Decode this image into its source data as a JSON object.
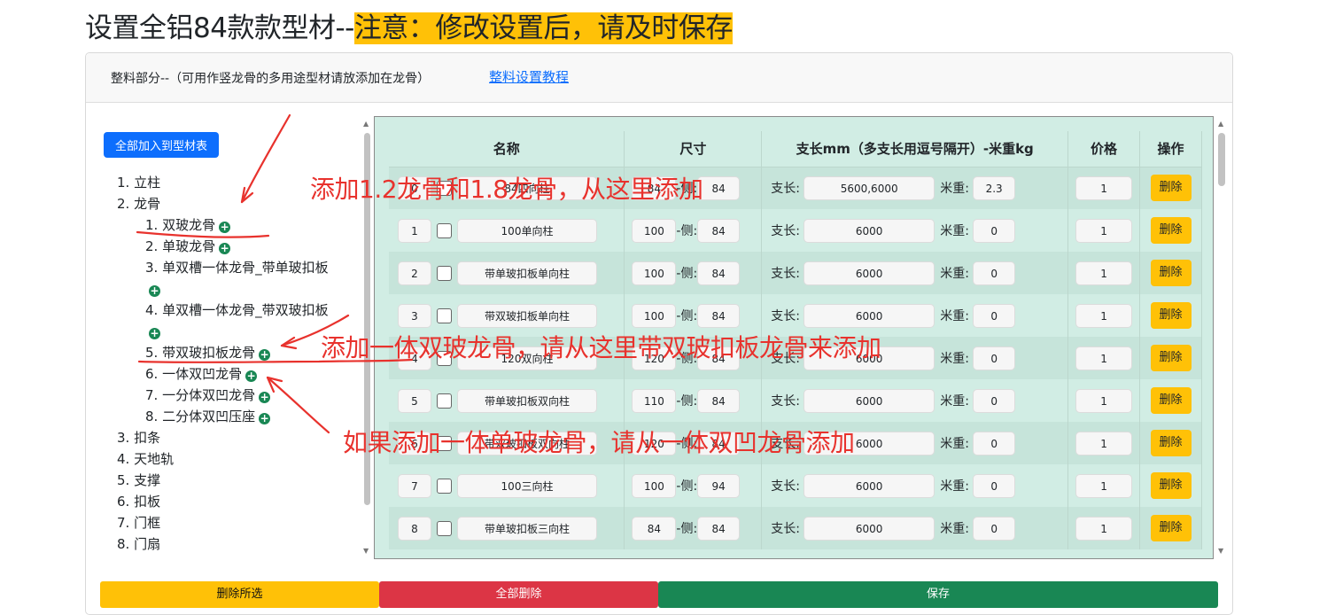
{
  "title": {
    "main": "设置全铝84款款型材--",
    "highlight": "注意：修改设置后，请及时保存"
  },
  "header": {
    "description": "整料部分--（可用作竖龙骨的多用途型材请放添加在龙骨）",
    "tutorial_link": "整料设置教程"
  },
  "tree": {
    "add_all_label": "全部加入到型材表",
    "items": [
      {
        "label": "1. 立柱",
        "level": 0,
        "plus": false
      },
      {
        "label": "2. 龙骨",
        "level": 0,
        "plus": false
      },
      {
        "label": "1. 双玻龙骨",
        "level": 1,
        "plus": true
      },
      {
        "label": "2. 单玻龙骨",
        "level": 1,
        "plus": true
      },
      {
        "label": "3. 单双槽一体龙骨_带单玻扣板",
        "level": 1,
        "plus": false
      },
      {
        "label": "",
        "level": 1,
        "plus": true
      },
      {
        "label": "4. 单双槽一体龙骨_带双玻扣板",
        "level": 1,
        "plus": false
      },
      {
        "label": "",
        "level": 1,
        "plus": true
      },
      {
        "label": "5. 带双玻扣板龙骨",
        "level": 1,
        "plus": true
      },
      {
        "label": "6. 一体双凹龙骨",
        "level": 1,
        "plus": true
      },
      {
        "label": "7. 一分体双凹龙骨",
        "level": 1,
        "plus": true
      },
      {
        "label": "8. 二分体双凹压座",
        "level": 1,
        "plus": true
      },
      {
        "label": "3. 扣条",
        "level": 0,
        "plus": false
      },
      {
        "label": "4. 天地轨",
        "level": 0,
        "plus": false
      },
      {
        "label": "5. 支撑",
        "level": 0,
        "plus": false
      },
      {
        "label": "6. 扣板",
        "level": 0,
        "plus": false
      },
      {
        "label": "7. 门框",
        "level": 0,
        "plus": false
      },
      {
        "label": "8. 门扇",
        "level": 0,
        "plus": false
      }
    ]
  },
  "table": {
    "headers": [
      "名称",
      "尺寸",
      "支长mm（多支长用逗号隔开）-米重kg",
      "价格",
      "操作"
    ],
    "side_label": "-侧:",
    "length_label": "支长:",
    "weight_label": "米重:",
    "delete_label": "删除",
    "rows": [
      {
        "idx": "0",
        "name": "84四向柱",
        "size": "84",
        "side": "84",
        "length": "5600,6000",
        "weight": "2.3",
        "price": "1"
      },
      {
        "idx": "1",
        "name": "100单向柱",
        "size": "100",
        "side": "84",
        "length": "6000",
        "weight": "0",
        "price": "1"
      },
      {
        "idx": "2",
        "name": "带单玻扣板单向柱",
        "size": "100",
        "side": "84",
        "length": "6000",
        "weight": "0",
        "price": "1"
      },
      {
        "idx": "3",
        "name": "带双玻扣板单向柱",
        "size": "100",
        "side": "84",
        "length": "6000",
        "weight": "0",
        "price": "1"
      },
      {
        "idx": "4",
        "name": "120双向柱",
        "size": "120",
        "side": "84",
        "length": "6000",
        "weight": "0",
        "price": "1"
      },
      {
        "idx": "5",
        "name": "带单玻扣板双向柱",
        "size": "110",
        "side": "84",
        "length": "6000",
        "weight": "0",
        "price": "1"
      },
      {
        "idx": "6",
        "name": "带双玻扣板双向柱",
        "size": "120",
        "side": "84",
        "length": "6000",
        "weight": "0",
        "price": "1"
      },
      {
        "idx": "7",
        "name": "100三向柱",
        "size": "100",
        "side": "94",
        "length": "6000",
        "weight": "0",
        "price": "1"
      },
      {
        "idx": "8",
        "name": "带单玻扣板三向柱",
        "size": "84",
        "side": "84",
        "length": "6000",
        "weight": "0",
        "price": "1"
      }
    ]
  },
  "footer": {
    "delete_selected": "删除所选",
    "delete_all": "全部删除",
    "save": "保存"
  },
  "annotations": [
    "添加1.2龙骨和1.8龙骨，从这里添加",
    "添加一体双玻龙骨，请从这里带双玻扣板龙骨来添加",
    "如果添加一体单玻龙骨，请从一体双凹龙骨添加"
  ],
  "colors": {
    "primary": "#0d6efd",
    "warning": "#ffc107",
    "danger": "#dc3545",
    "success": "#198754",
    "grid_bg": "#d1ede4",
    "annotation": "#e8322d"
  }
}
